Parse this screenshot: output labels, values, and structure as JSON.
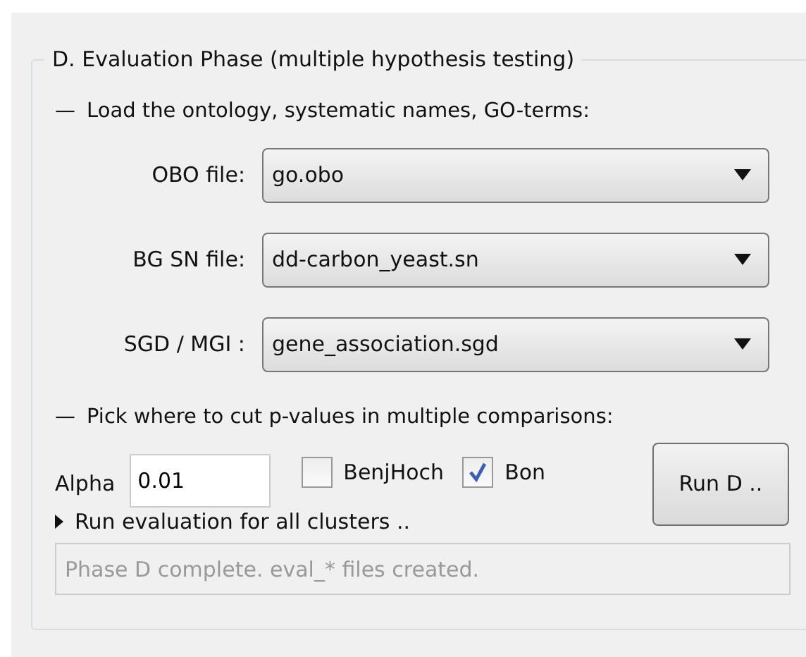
{
  "group": {
    "title": "D. Evaluation Phase (multiple hypothesis testing)"
  },
  "load_section": {
    "dash": "—",
    "label": "Load the ontology, systematic names, GO-terms:"
  },
  "file_rows": [
    {
      "label": "OBO file:",
      "value": "go.obo"
    },
    {
      "label": "BG SN file:",
      "value": "dd-carbon_yeast.sn"
    },
    {
      "label": "SGD / MGI :",
      "value": "gene_association.sgd"
    }
  ],
  "cut_section": {
    "dash": "—",
    "label": "Pick where to cut p-values in multiple comparisons:"
  },
  "alpha": {
    "label": "Alpha",
    "value": "0.01"
  },
  "checkboxes": [
    {
      "label": "BenjHoch",
      "checked": false
    },
    {
      "label": "Bon",
      "checked": true
    }
  ],
  "run_button": {
    "label": "Run D .."
  },
  "run_all": {
    "label": "Run evaluation for all clusters .."
  },
  "status": {
    "placeholder": "Phase D complete. eval_* files created."
  }
}
